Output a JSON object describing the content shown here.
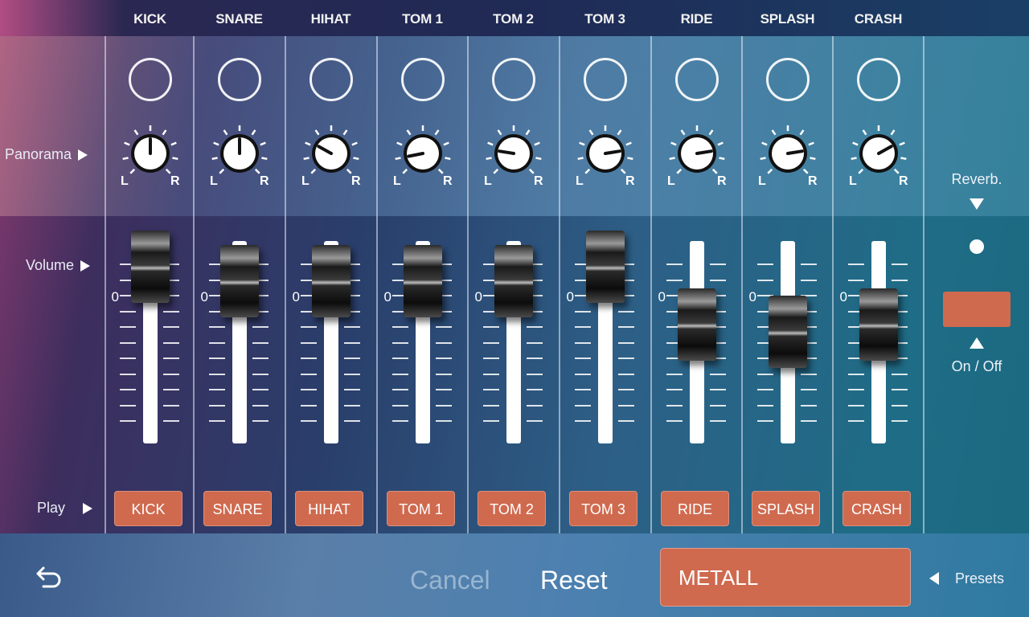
{
  "channels": [
    {
      "label": "KICK",
      "button": "KICK",
      "pan": 0,
      "volume_db": 2
    },
    {
      "label": "SNARE",
      "button": "SNARE",
      "pan": 0,
      "volume_db": 0
    },
    {
      "label": "HIHAT",
      "button": "HIHAT",
      "pan": -0.45,
      "volume_db": 0
    },
    {
      "label": "TOM 1",
      "button": "TOM 1",
      "pan": -0.75,
      "volume_db": 0
    },
    {
      "label": "TOM 2",
      "button": "TOM 2",
      "pan": -0.6,
      "volume_db": 0
    },
    {
      "label": "TOM 3",
      "button": "TOM 3",
      "pan": 0.6,
      "volume_db": 2
    },
    {
      "label": "RIDE",
      "button": "RIDE",
      "pan": 0.6,
      "volume_db": -6
    },
    {
      "label": "SPLASH",
      "button": "SPLASH",
      "pan": 0.6,
      "volume_db": -7
    },
    {
      "label": "CRASH",
      "button": "CRASH",
      "pan": 0.45,
      "volume_db": -6
    }
  ],
  "row_labels": {
    "panorama": "Panorama",
    "volume": "Volume",
    "play": "Play"
  },
  "knob_letters": {
    "left": "L",
    "right": "R"
  },
  "fader_zero_label": "0",
  "reverb": {
    "label": "Reverb.",
    "toggle_label": "On / Off"
  },
  "bottom": {
    "cancel": "Cancel",
    "reset": "Reset",
    "preset_value": "METALL",
    "presets_label": "Presets"
  },
  "icons": {
    "back": "back-arrow-icon"
  },
  "colors": {
    "accent": "#cf6a4f"
  }
}
